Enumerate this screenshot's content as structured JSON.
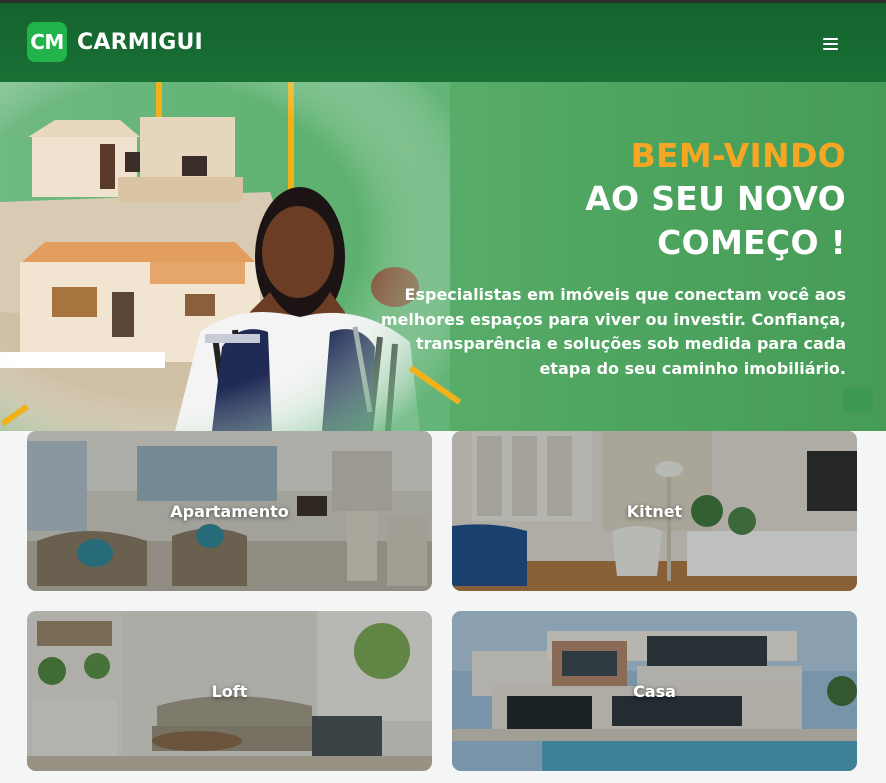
{
  "header": {
    "logo_badge": "CM",
    "brand_name": "CARMIGUI",
    "menu_icon": "hamburger-menu-icon"
  },
  "hero": {
    "title_line1": "BEM-VINDO",
    "title_line2": "AO SEU NOVO",
    "title_line3": "COMEÇO !",
    "description": "Especialistas em imóveis que conectam você aos melhores espaços para viver ou investir. Confiança, transparência e soluções sob medida para cada etapa do seu caminho imobiliário.",
    "accent_color": "#f5a623",
    "brand_color": "#1b7a3a"
  },
  "property_types": [
    {
      "label": "Apartamento"
    },
    {
      "label": "Kitnet"
    },
    {
      "label": "Loft"
    },
    {
      "label": "Casa"
    }
  ]
}
